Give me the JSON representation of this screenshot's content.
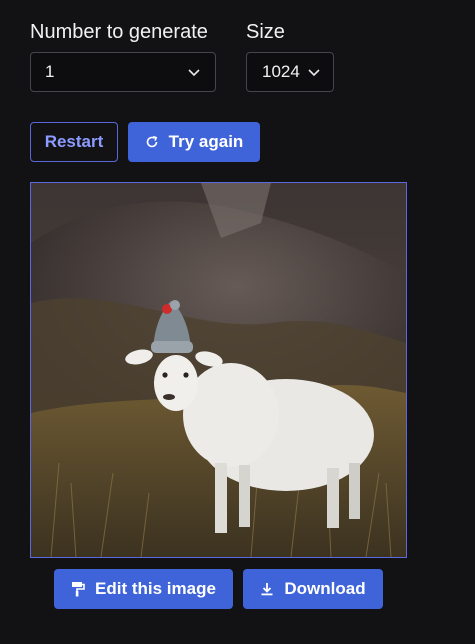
{
  "controls": {
    "number_label": "Number to generate",
    "number_value": "1",
    "size_label": "Size",
    "size_value": "1024"
  },
  "actions": {
    "restart_label": "Restart",
    "try_again_label": "Try again",
    "edit_label": "Edit this image",
    "download_label": "Download"
  },
  "icons": {
    "try_again": "refresh-icon",
    "edit": "paint-roller-icon",
    "download": "download-icon",
    "dropdown": "chevron-down-icon"
  },
  "colors": {
    "background": "#121215",
    "accent": "#3f63d8",
    "outline_accent": "#5a67d8"
  }
}
